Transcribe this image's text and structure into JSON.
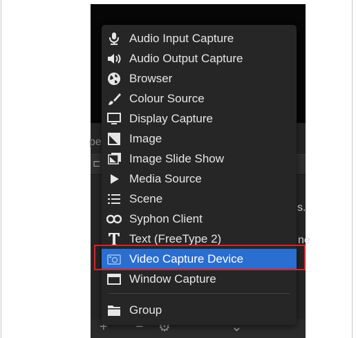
{
  "background": {
    "left_tab_fragment": "pe",
    "fragment_1": "s.",
    "fragment_2": "ne"
  },
  "menu": {
    "items": [
      {
        "label": "Audio Input Capture",
        "icon": "microphone-icon"
      },
      {
        "label": "Audio Output Capture",
        "icon": "speaker-icon"
      },
      {
        "label": "Browser",
        "icon": "globe-icon"
      },
      {
        "label": "Colour Source",
        "icon": "paintbrush-icon"
      },
      {
        "label": "Display Capture",
        "icon": "monitor-icon"
      },
      {
        "label": "Image",
        "icon": "image-icon"
      },
      {
        "label": "Image Slide Show",
        "icon": "slideshow-icon"
      },
      {
        "label": "Media Source",
        "icon": "play-icon"
      },
      {
        "label": "Scene",
        "icon": "list-icon"
      },
      {
        "label": "Syphon Client",
        "icon": "syphon-icon"
      },
      {
        "label": "Text (FreeType 2)",
        "icon": "text-icon"
      },
      {
        "label": "Video Capture Device",
        "icon": "camera-icon",
        "selected": true
      },
      {
        "label": "Window Capture",
        "icon": "window-icon"
      },
      {
        "label": "Group",
        "icon": "folder-icon"
      }
    ]
  },
  "colors": {
    "menu_bg": "#262626",
    "selection": "#2a6ed0",
    "highlight_border": "#d0262b"
  }
}
